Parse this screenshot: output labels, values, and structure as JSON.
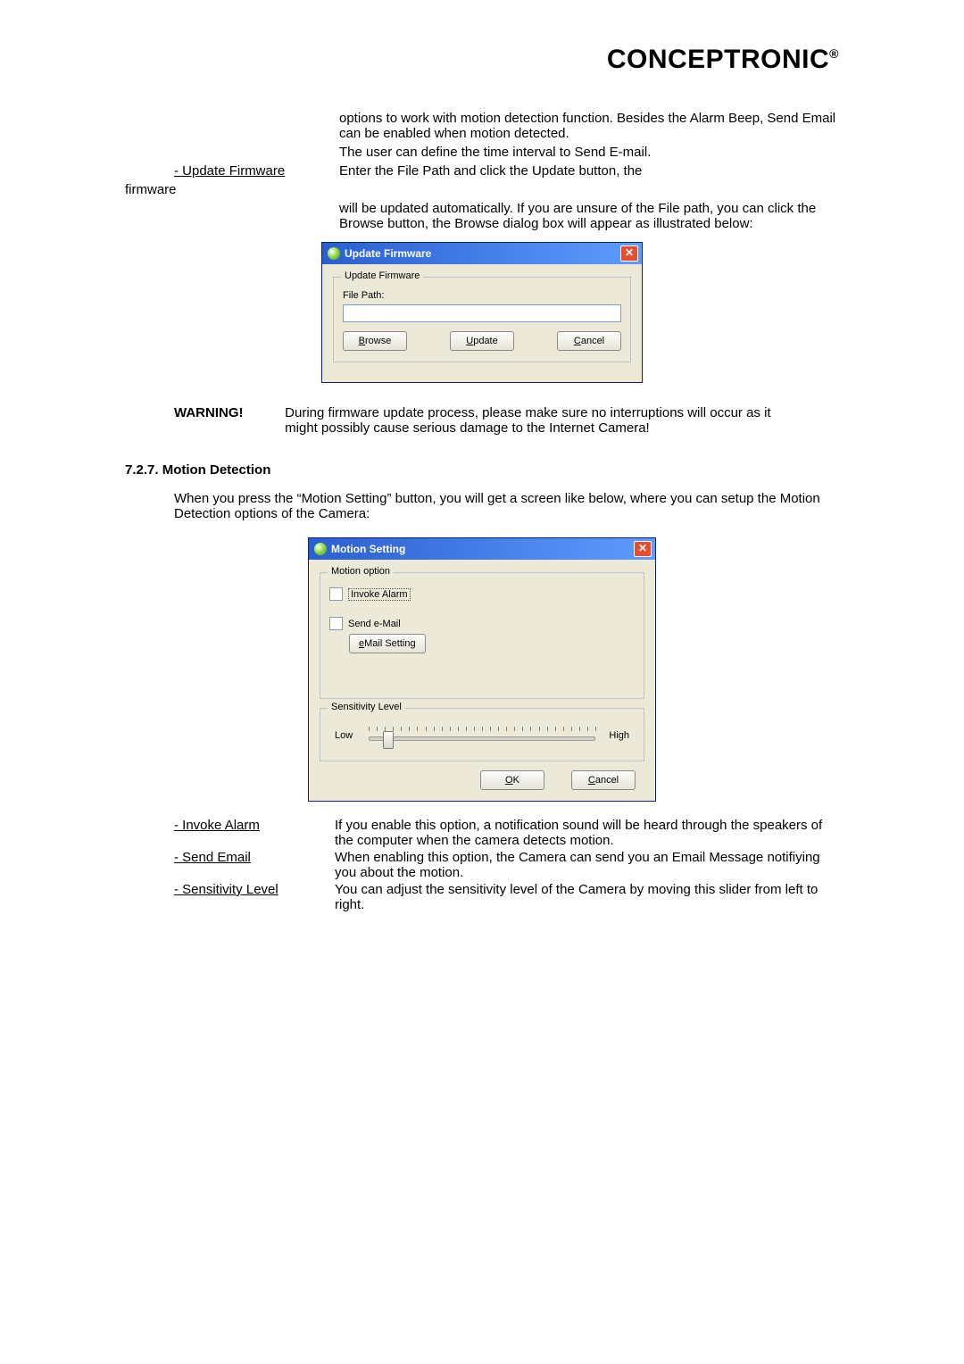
{
  "brand": "CONCEPTRONIC",
  "brand_reg": "®",
  "top_para": "options to work with motion detection function. Besides the Alarm Beep, Send Email can be enabled when motion detected.",
  "top_para2": "The user can define the time interval to Send E-mail.",
  "update_label": "- Update Firmware",
  "update_text": "Enter the  File Path and click the  Update button, the",
  "firmware_word": "firmware",
  "update_text2": "will be updated automatically. If you are unsure of the File path, you can click the  Browse button, the Browse dialog box will appear as illustrated below:",
  "dialog1": {
    "title": "Update Firmware",
    "group": "Update Firmware",
    "filepath": "File Path:",
    "browse": "Browse",
    "update": "Update",
    "cancel": "Cancel"
  },
  "warning_label": "WARNING!",
  "warning_text": "During firmware update process, please make sure no interruptions will occur as it might possibly cause serious damage to the Internet Camera!",
  "section_head": "7.2.7. Motion Detection",
  "section_para": "When you press the “Motion Setting” button, you will get a screen like below, where you can setup the Motion Detection options of the Camera:",
  "dialog2": {
    "title": "Motion Setting",
    "group1": "Motion option",
    "invoke": "Invoke Alarm",
    "sendemail": "Send e-Mail",
    "emailbtn": "eMail Setting",
    "group2": "Sensitivity Level",
    "low": "Low",
    "high": "High",
    "ok": "OK",
    "cancel": "Cancel"
  },
  "defs": {
    "invoke_label": "- Invoke Alarm",
    "invoke_text": "If you enable this option, a notification sound will be heard through the speakers of the computer when the camera detects motion.",
    "send_label": "- Send Email",
    "send_text": "When enabling this option, the Camera can send you an Email Message notifiying you about the motion.",
    "sens_label": "- Sensitivity Level",
    "sens_text": "You can adjust the sensitivity level of the Camera by moving this slider from left to right."
  }
}
